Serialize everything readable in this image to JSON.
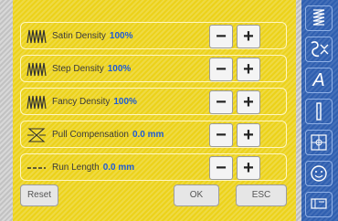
{
  "rows": [
    {
      "label": "Satin Density",
      "value": "100%"
    },
    {
      "label": "Step Density",
      "value": "100%"
    },
    {
      "label": "Fancy Density",
      "value": "100%"
    },
    {
      "label": "Pull Compensation",
      "value": "0.0 mm"
    },
    {
      "label": "Run Length",
      "value": "0.0 mm"
    }
  ],
  "buttons": {
    "minus": "−",
    "plus": "+",
    "reset": "Reset",
    "ok": "OK",
    "esc": "ESC"
  },
  "sidebar": {
    "text_icon": "A"
  },
  "icons": [
    "satin-density-icon",
    "step-density-icon",
    "fancy-density-icon",
    "pull-compensation-icon",
    "run-length-icon",
    "zigzag-icon",
    "stitch-edit-icon",
    "lettering-icon",
    "bar-icon",
    "grid-icon",
    "smiley-icon",
    "tools-icon"
  ],
  "colors": {
    "panel": "#ecd21a",
    "value": "#1e5bd6",
    "sidebar": "#2f5fb0"
  }
}
